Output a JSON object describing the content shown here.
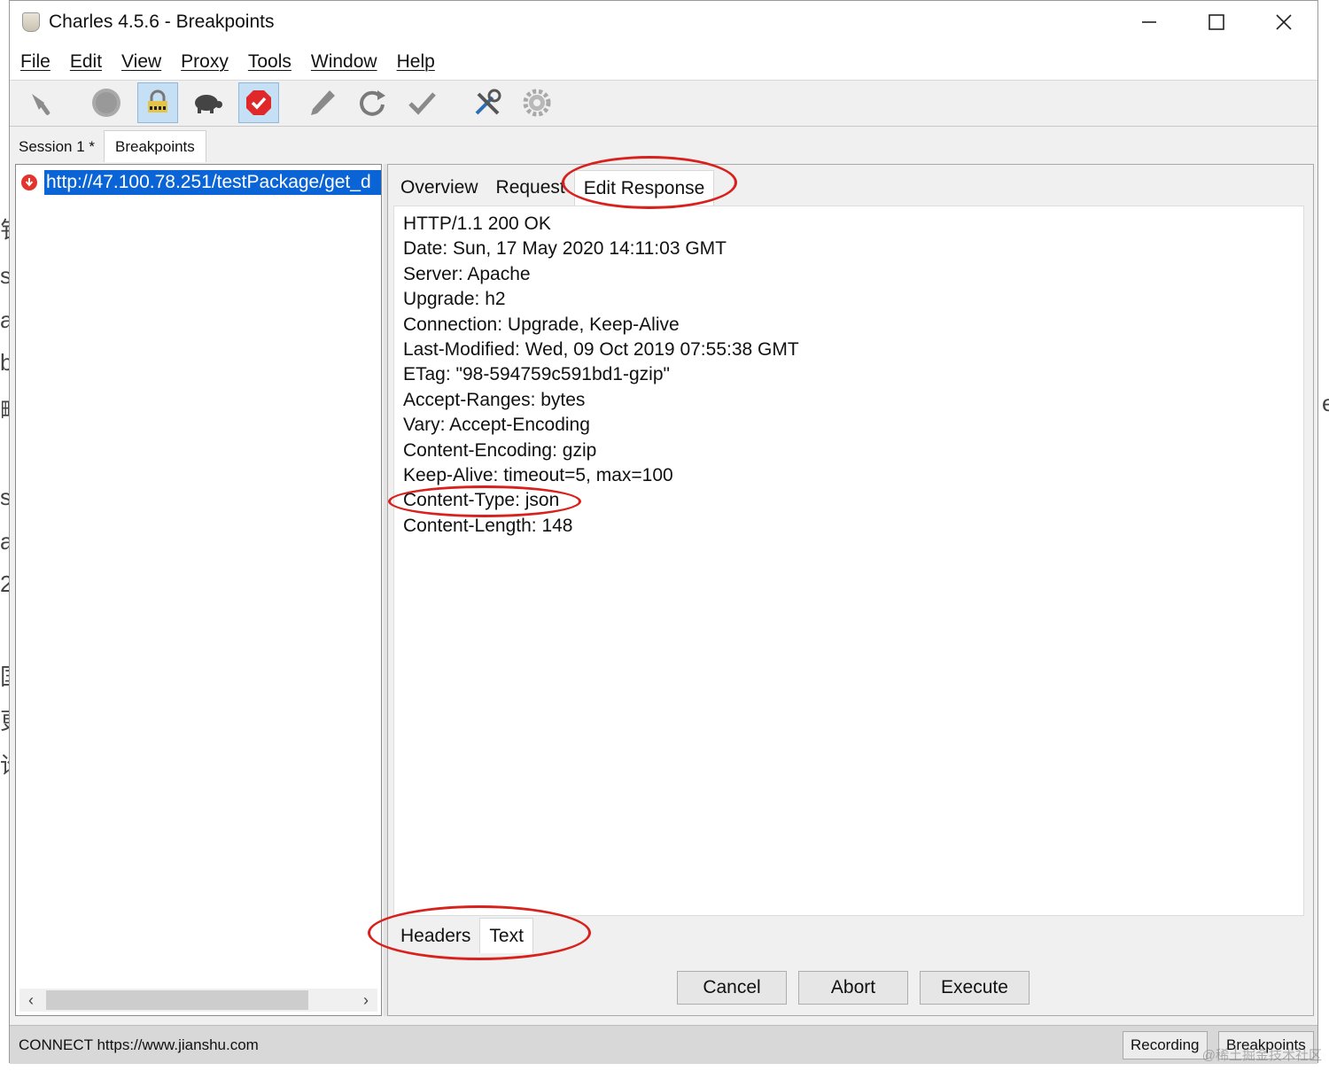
{
  "window": {
    "title": "Charles 4.5.6 - Breakpoints",
    "controls": {
      "minimize": "—",
      "maximize": "☐",
      "close": "✕"
    }
  },
  "menu": [
    "File",
    "Edit",
    "View",
    "Proxy",
    "Tools",
    "Window",
    "Help"
  ],
  "toolbar": {
    "buttons": [
      {
        "icon": "broom-icon",
        "state": "normal"
      },
      {
        "icon": "record-icon",
        "state": "normal"
      },
      {
        "icon": "throttle-lock-icon",
        "state": "active"
      },
      {
        "icon": "turtle-icon",
        "state": "normal"
      },
      {
        "icon": "breakpoint-stop-icon",
        "state": "active"
      },
      {
        "icon": "pen-icon",
        "state": "normal"
      },
      {
        "icon": "refresh-icon",
        "state": "normal"
      },
      {
        "icon": "checkmark-icon",
        "state": "normal"
      },
      {
        "icon": "tools-icon",
        "state": "normal"
      },
      {
        "icon": "gear-icon",
        "state": "normal"
      }
    ]
  },
  "session_tabs": [
    "Session 1 *",
    "Breakpoints"
  ],
  "tree": {
    "url": "http://47.100.78.251/testPackage/get_d"
  },
  "detail_tabs": [
    "Overview",
    "Request",
    "Edit Response"
  ],
  "response_headers": [
    "HTTP/1.1 200 OK",
    "Date: Sun, 17 May 2020 14:11:03 GMT",
    "Server: Apache",
    "Upgrade: h2",
    "Connection: Upgrade, Keep-Alive",
    "Last-Modified: Wed, 09 Oct 2019 07:55:38 GMT",
    "ETag: \"98-594759c591bd1-gzip\"",
    "Accept-Ranges: bytes",
    "Vary: Accept-Encoding",
    "Content-Encoding: gzip",
    "Keep-Alive: timeout=5, max=100",
    "Content-Type: json",
    "Content-Length: 148"
  ],
  "bottom_tabs": [
    "Headers",
    "Text"
  ],
  "actions": [
    "Cancel",
    "Abort",
    "Execute"
  ],
  "status": {
    "text": "CONNECT https://www.jianshu.com",
    "recording": "Recording",
    "breakpoints": "Breakpoints"
  },
  "background_fragments": [
    "钅",
    "s",
    "a",
    "b",
    "略",
    "s",
    "a",
    "2",
    "国",
    "更",
    "论"
  ],
  "background_fragment_right": "e",
  "watermark": "@稀土掘金技术社区",
  "colors": {
    "selection": "#0a64d6",
    "annotation": "#d8211c",
    "breakpoint": "#e2342c",
    "active_button": "#c5dff5"
  }
}
